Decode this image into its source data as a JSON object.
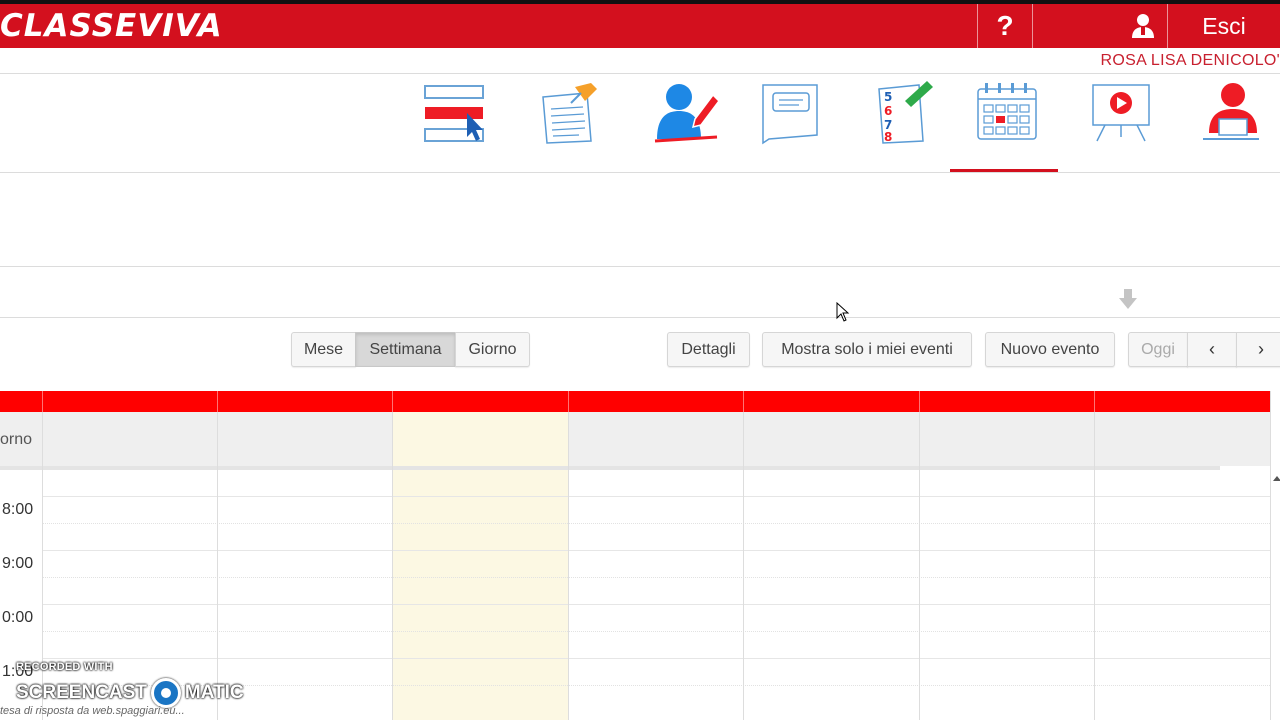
{
  "header": {
    "logo": "CLASSEVIVA",
    "help": "?",
    "exit_label": "Esci",
    "user_name": "ROSA LISA DENICOLO'",
    "brand_color": "#d3101e"
  },
  "nav": {
    "icons": [
      "registro-icon",
      "note-icon",
      "docente-icon",
      "lavagna-icon",
      "voti-icon",
      "agenda-icon",
      "video-icon",
      "utente-icon"
    ],
    "active": "agenda-icon"
  },
  "calendar": {
    "views": {
      "month": "Mese",
      "week": "Settimana",
      "day": "Giorno"
    },
    "active_view": "Settimana",
    "actions": {
      "details": "Dettagli",
      "my_events": "Mostra solo i miei eventi",
      "new_event": "Nuovo evento",
      "today": "Oggi"
    },
    "allday_label": "orno",
    "times": [
      "8:00",
      "9:00",
      "0:00",
      "1:00"
    ],
    "header_color": "#ff0000",
    "today_color": "#fcf8e3"
  },
  "overlay": {
    "recorded_with": "RECORDED WITH",
    "screencast_left": "SCREENCAST",
    "screencast_right": "MATIC",
    "status": "tesa di risposta da web.spaggiari.eu..."
  }
}
